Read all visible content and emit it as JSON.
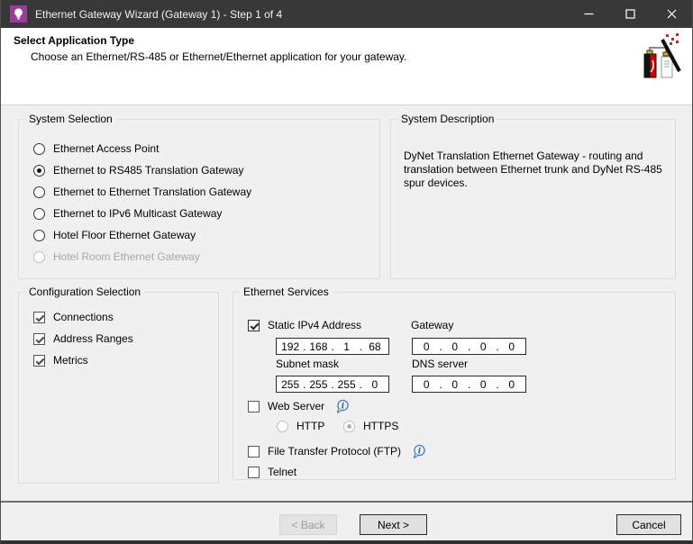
{
  "colors": {
    "titlebar_bg": "#383838",
    "app_icon_purple": "#9b3b9b",
    "header_bg": "#ffffff",
    "body_bg": "#f0f0f0",
    "info_icon_blue": "#4a7dbd",
    "sparkle_red": "#cc2222",
    "disabled_text": "#a6a6a6"
  },
  "titlebar": {
    "title": "Ethernet Gateway Wizard (Gateway 1) - Step 1 of 4"
  },
  "header": {
    "title": "Select Application Type",
    "subtitle": "Choose an Ethernet/RS-485 or Ethernet/Ethernet application for your gateway."
  },
  "system_selection": {
    "title": "System Selection",
    "options": [
      {
        "label": "Ethernet Access Point",
        "selected": false,
        "disabled": false
      },
      {
        "label": "Ethernet to RS485 Translation Gateway",
        "selected": true,
        "disabled": false
      },
      {
        "label": "Ethernet to Ethernet Translation Gateway",
        "selected": false,
        "disabled": false
      },
      {
        "label": "Ethernet to IPv6 Multicast Gateway",
        "selected": false,
        "disabled": false
      },
      {
        "label": "Hotel Floor Ethernet Gateway",
        "selected": false,
        "disabled": false
      },
      {
        "label": "Hotel Room Ethernet Gateway",
        "selected": false,
        "disabled": true
      }
    ]
  },
  "system_description": {
    "title": "System Description",
    "text": "DyNet Translation Ethernet Gateway - routing and translation between Ethernet trunk and DyNet RS-485 spur devices."
  },
  "configuration_selection": {
    "title": "Configuration Selection",
    "options": [
      {
        "label": "Connections",
        "checked": true
      },
      {
        "label": "Address Ranges",
        "checked": true
      },
      {
        "label": "Metrics",
        "checked": true
      }
    ]
  },
  "ethernet_services": {
    "title": "Ethernet Services",
    "static_ipv4": {
      "label": "Static IPv4 Address",
      "checked": true
    },
    "ip_address": {
      "value": [
        "192",
        "168",
        "1",
        "68"
      ]
    },
    "gateway": {
      "label": "Gateway",
      "value": [
        "0",
        "0",
        "0",
        "0"
      ]
    },
    "subnet_mask": {
      "label": "Subnet mask",
      "value": [
        "255",
        "255",
        "255",
        "0"
      ]
    },
    "dns_server": {
      "label": "DNS server",
      "value": [
        "0",
        "0",
        "0",
        "0"
      ]
    },
    "web_server": {
      "label": "Web Server",
      "checked": false
    },
    "http": {
      "label": "HTTP",
      "selected": false,
      "disabled": true
    },
    "https": {
      "label": "HTTPS",
      "selected": true,
      "disabled": true
    },
    "ftp": {
      "label": "File Transfer Protocol (FTP)",
      "checked": false
    },
    "telnet": {
      "label": "Telnet",
      "checked": false
    }
  },
  "footer": {
    "back_label": "< Back",
    "next_label": "Next >",
    "cancel_label": "Cancel"
  }
}
